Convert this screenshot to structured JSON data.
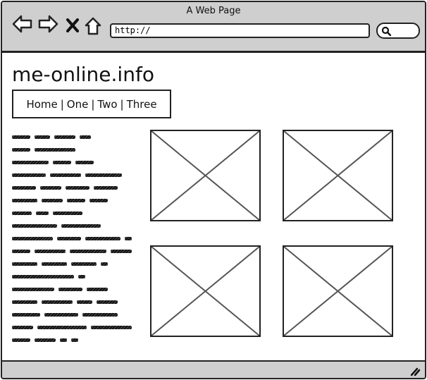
{
  "window": {
    "title": "A Web Page"
  },
  "toolbar": {
    "back_icon": "back-arrow-icon",
    "forward_icon": "forward-arrow-icon",
    "stop_icon": "close-x-icon",
    "home_icon": "home-icon",
    "url_value": "http://",
    "search_icon": "search-icon"
  },
  "page": {
    "site_title": "me-online.info",
    "nav": [
      "Home",
      "One",
      "Two",
      "Three"
    ],
    "nav_separator": "|",
    "body_text_lines": 17,
    "image_placeholders": 4
  },
  "statusbar": {
    "resize_icon": "resize-grip-icon"
  }
}
